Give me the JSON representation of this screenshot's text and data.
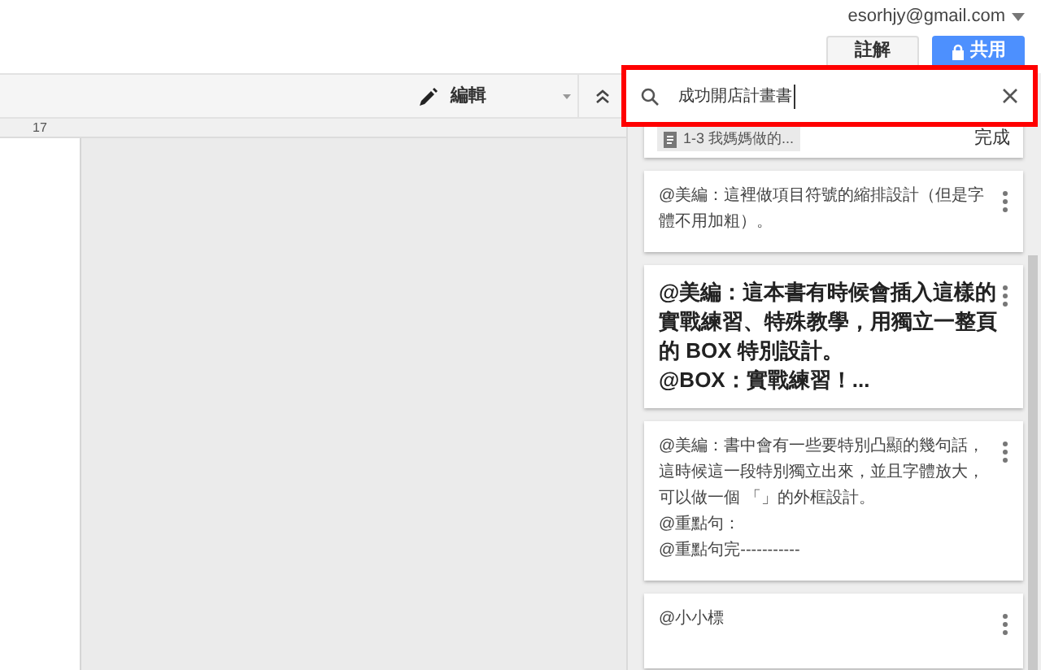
{
  "account": {
    "email": "esorhjy@gmail.com"
  },
  "header_buttons": [
    {
      "label": "註解",
      "kind": "plain"
    },
    {
      "label": "共用",
      "kind": "primary"
    }
  ],
  "toolbar": {
    "mode": "編輯"
  },
  "ruler": {
    "mark": "17"
  },
  "search": {
    "value": "成功開店計畫書"
  },
  "top_card": {
    "chip": "1-3 我媽媽做的...",
    "action": "完成"
  },
  "comments": [
    {
      "kind": "small",
      "lines": [
        "@美編：這裡做項目符號的縮排設計（但是字體不用加粗）。"
      ]
    },
    {
      "kind": "large",
      "lines": [
        "@美編：這本書有時候會插入這樣的實戰練習、特殊教學，用獨立一整頁的 BOX 特別設計。",
        "@BOX：實戰練習！..."
      ]
    },
    {
      "kind": "small",
      "lines": [
        "@美編：書中會有一些要特別凸顯的幾句話，這時候這一段特別獨立出來，並且字體放大，可以做一個 「」的外框設計。",
        "@重點句：",
        "@重點句完-----------"
      ]
    },
    {
      "kind": "small",
      "lines": [
        "@小小標"
      ]
    }
  ]
}
